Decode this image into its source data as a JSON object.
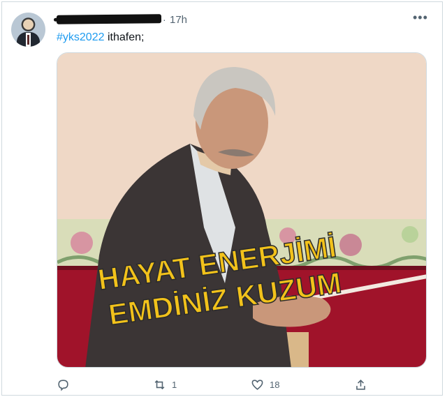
{
  "tweet": {
    "time": "17h",
    "separator": "·",
    "more_icon": "more-horizontal-icon",
    "hashtag": "#yks2022",
    "text_rest": " ithafen;",
    "media": {
      "caption_line1": "HAYAT ENERJİMİ",
      "caption_line2": "EMDİNİZ KUZUM",
      "caption_color": "#f2c21b"
    },
    "actions": {
      "reply_icon": "reply-icon",
      "retweet_icon": "retweet-icon",
      "retweet_count": "1",
      "like_icon": "like-icon",
      "like_count": "18",
      "share_icon": "share-icon"
    }
  },
  "colors": {
    "link": "#1d9bf0",
    "muted": "#536471"
  }
}
